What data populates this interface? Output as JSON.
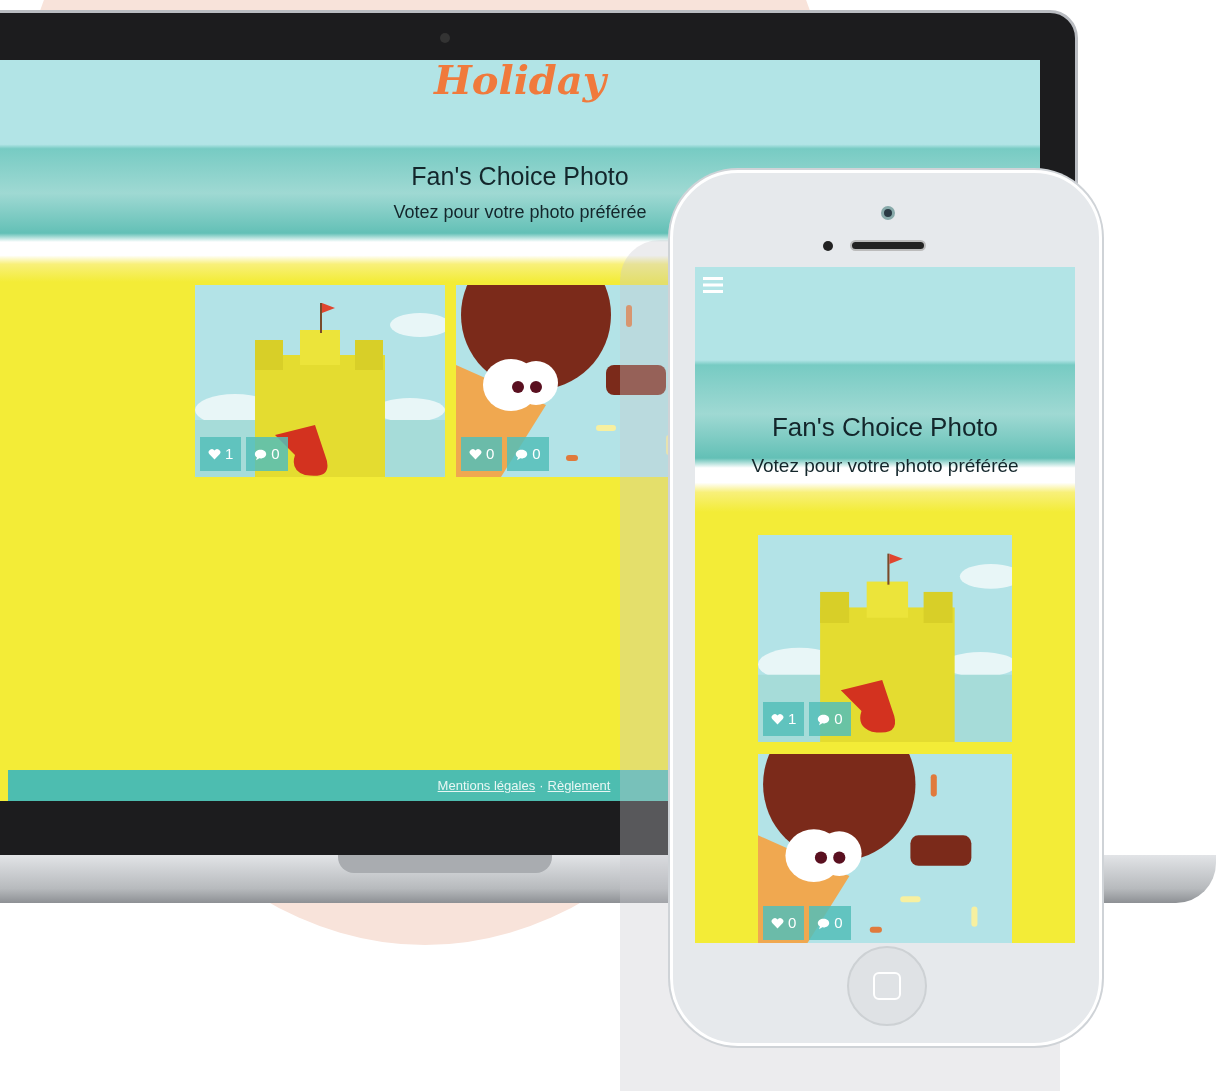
{
  "desktop": {
    "logo": "Holiday",
    "title": "Fan's Choice Photo",
    "subtitle": "Votez pour votre photo préférée",
    "photos": [
      {
        "kind": "castle",
        "likes": "1",
        "comments": "0"
      },
      {
        "kind": "icecream",
        "likes": "0",
        "comments": "0"
      }
    ],
    "footer_links": [
      "Mentions légales",
      "Règlement"
    ],
    "footer_separator": "·"
  },
  "mobile": {
    "title": "Fan's Choice Photo",
    "subtitle": "Votez pour votre photo préférée",
    "photos": [
      {
        "kind": "castle",
        "likes": "1",
        "comments": "0"
      },
      {
        "kind": "icecream",
        "likes": "0",
        "comments": "0"
      }
    ]
  }
}
